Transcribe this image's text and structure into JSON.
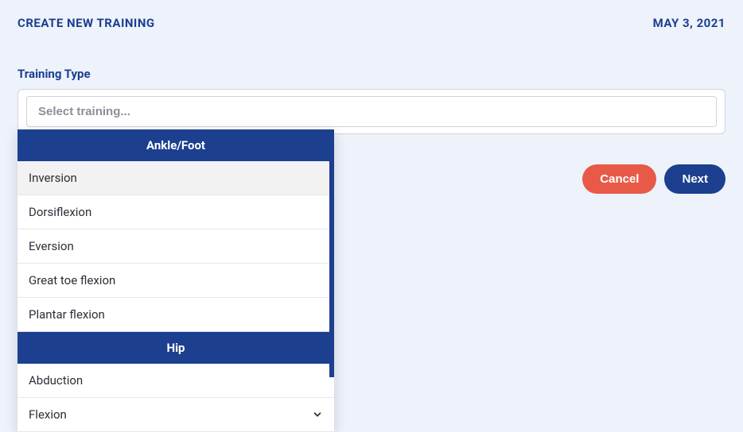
{
  "header": {
    "title": "CREATE NEW TRAINING",
    "date": "MAY 3, 2021"
  },
  "field": {
    "label": "Training Type",
    "placeholder": "Select training..."
  },
  "dropdown": {
    "group1_label": "Ankle/Foot",
    "options1": {
      "0": "Inversion",
      "1": "Dorsiflexion",
      "2": "Eversion",
      "3": "Great toe flexion",
      "4": "Plantar flexion"
    },
    "group2_label": "Hip",
    "options2": {
      "0": "Abduction",
      "1": "Flexion"
    }
  },
  "actions": {
    "cancel": "Cancel",
    "next": "Next"
  }
}
